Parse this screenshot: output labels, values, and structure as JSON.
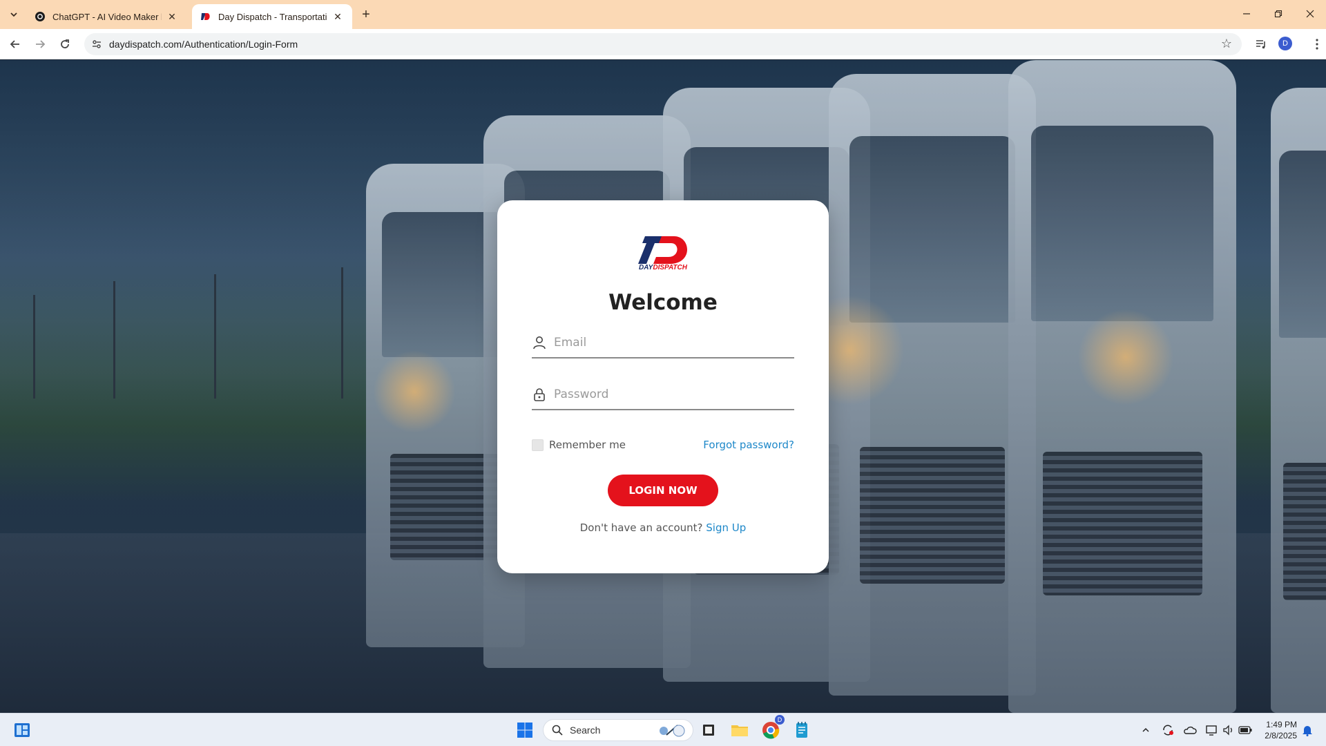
{
  "browser": {
    "tabs": [
      {
        "title": "ChatGPT - AI Video Maker by D",
        "active": false
      },
      {
        "title": "Day Dispatch - Transportation |",
        "active": true
      }
    ],
    "url": "daydispatch.com/Authentication/Login-Form",
    "profile_initial": "D"
  },
  "login": {
    "brand_name": "DAYDISPATCH",
    "heading": "Welcome",
    "email_placeholder": "Email",
    "password_placeholder": "Password",
    "remember_label": "Remember me",
    "forgot_label": "Forgot password?",
    "login_button": "LOGIN NOW",
    "signup_prompt": "Don't have an account?",
    "signup_link": "Sign Up"
  },
  "colors": {
    "brand_red": "#e4121c",
    "brand_navy": "#1a2f6b",
    "link_blue": "#1e88c9",
    "tab_strip": "#fbd9b5"
  },
  "taskbar": {
    "search_placeholder": "Search",
    "time": "1:49 PM",
    "date": "2/8/2025",
    "chrome_badge": "D"
  }
}
